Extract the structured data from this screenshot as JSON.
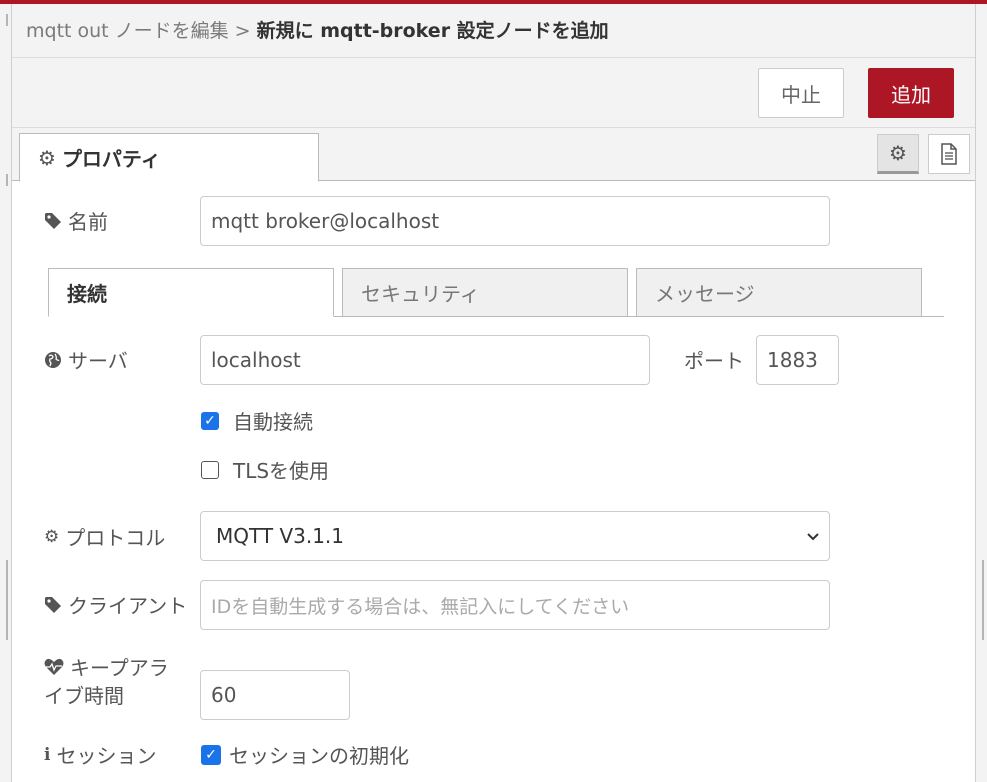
{
  "breadcrumb": {
    "parent": "mqtt out ノードを編集",
    "separator": ">",
    "current": "新規に mqtt-broker 設定ノードを追加"
  },
  "toolbar": {
    "cancel_label": "中止",
    "add_label": "追加"
  },
  "main_tab": {
    "label": "プロパティ"
  },
  "form": {
    "name": {
      "label": "名前",
      "value": "mqtt broker@localhost"
    },
    "sub_tabs": [
      {
        "label": "接続",
        "active": true
      },
      {
        "label": "セキュリティ",
        "active": false
      },
      {
        "label": "メッセージ",
        "active": false
      }
    ],
    "server": {
      "label": "サーバ",
      "value": "localhost"
    },
    "port": {
      "label": "ポート",
      "value": "1883"
    },
    "auto_connect": {
      "label": "自動接続",
      "checked": true
    },
    "use_tls": {
      "label": "TLSを使用",
      "checked": false
    },
    "protocol": {
      "label": "プロトコル",
      "selected": "MQTT V3.1.1"
    },
    "client": {
      "label": "クライアント",
      "placeholder": "IDを自動生成する場合は、無記入にしてください"
    },
    "keepalive": {
      "label_line1": "キープアラ",
      "label_line2": "イブ時間",
      "value": "60"
    },
    "session": {
      "label": "セッション",
      "checkbox_label": "セッションの初期化",
      "checked": true
    }
  },
  "colors": {
    "accent": "#ad1625",
    "checkbox_checked": "#1a73e8"
  },
  "icons": {
    "main_tab": "cog-icon",
    "name": "tag-icon",
    "server": "globe-icon",
    "protocol": "cog-icon",
    "client": "tag-icon",
    "keepalive": "heartbeat-icon",
    "session": "info-icon",
    "settings_button": "cog-icon",
    "info_button": "document-icon"
  }
}
